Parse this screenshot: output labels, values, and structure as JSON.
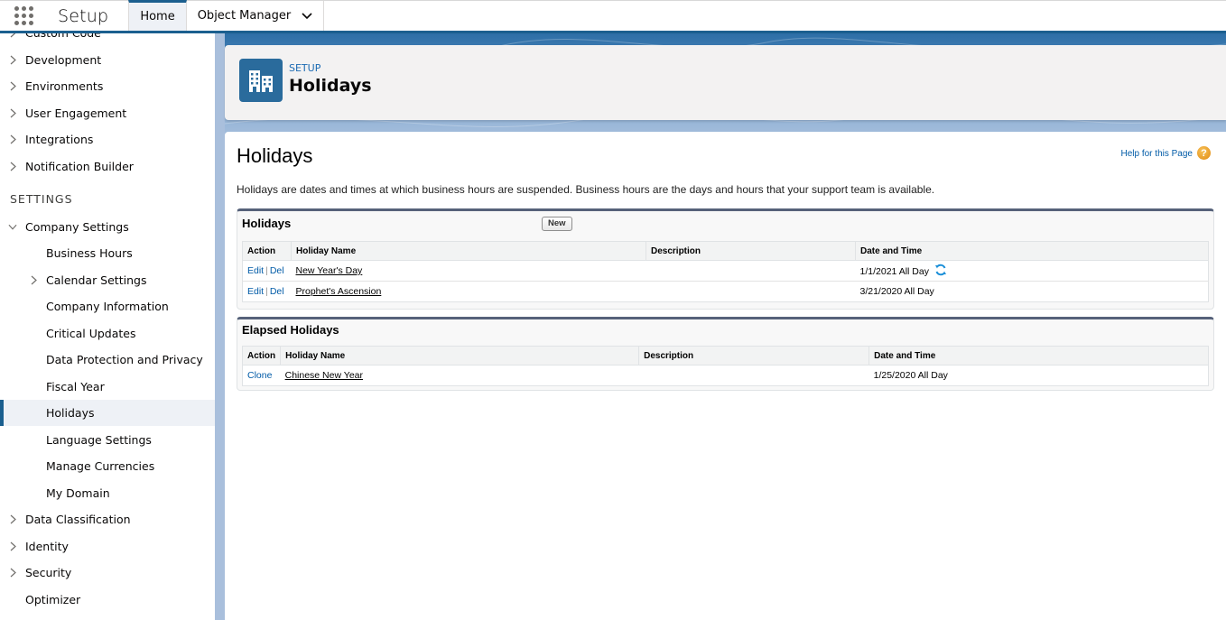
{
  "topbar": {
    "app_name": "Setup",
    "tabs": [
      {
        "label": "Home",
        "active": true
      },
      {
        "label": "Object Manager",
        "has_dropdown": true
      }
    ]
  },
  "sidebar": {
    "partial_item": "Custom Code",
    "top_items": [
      {
        "label": "Development"
      },
      {
        "label": "Environments"
      },
      {
        "label": "User Engagement"
      },
      {
        "label": "Integrations"
      },
      {
        "label": "Notification Builder"
      }
    ],
    "settings_heading": "SETTINGS",
    "company_settings": {
      "label": "Company Settings",
      "expanded": true,
      "children": [
        {
          "label": "Business Hours"
        },
        {
          "label": "Calendar Settings",
          "expandable": true
        },
        {
          "label": "Company Information"
        },
        {
          "label": "Critical Updates"
        },
        {
          "label": "Data Protection and Privacy"
        },
        {
          "label": "Fiscal Year"
        },
        {
          "label": "Holidays",
          "selected": true
        },
        {
          "label": "Language Settings"
        },
        {
          "label": "Manage Currencies"
        },
        {
          "label": "My Domain"
        }
      ]
    },
    "bottom_items": [
      {
        "label": "Data Classification",
        "expandable": true
      },
      {
        "label": "Identity",
        "expandable": true
      },
      {
        "label": "Security",
        "expandable": true
      },
      {
        "label": "Optimizer",
        "expandable": false
      }
    ]
  },
  "header": {
    "icon": "building-icon",
    "eyebrow": "SETUP",
    "title": "Holidays"
  },
  "content": {
    "title": "Holidays",
    "help_link": "Help for this Page",
    "description": "Holidays are dates and times at which business hours are suspended. Business hours are the days and hours that your support team is available.",
    "holidays_list": {
      "title": "Holidays",
      "new_button": "New",
      "columns": [
        "Action",
        "Holiday Name",
        "Description",
        "Date and Time"
      ],
      "rows": [
        {
          "edit": "Edit",
          "sep": "|",
          "del": "Del",
          "name": "New Year's Day",
          "description": "",
          "date": "1/1/2021 All Day",
          "recurring": true
        },
        {
          "edit": "Edit",
          "sep": "|",
          "del": "Del",
          "name": "Prophet's Ascension",
          "description": "",
          "date": "3/21/2020 All Day",
          "recurring": false
        }
      ]
    },
    "elapsed_list": {
      "title": "Elapsed Holidays",
      "columns": [
        "Action",
        "Holiday Name",
        "Description",
        "Date and Time"
      ],
      "rows": [
        {
          "clone": "Clone",
          "name": "Chinese New Year",
          "description": "",
          "date": "1/25/2020 All Day"
        }
      ]
    }
  },
  "colors": {
    "brand": "#1b5f8f",
    "link": "#015ba7",
    "header_icon_bg": "#2a6b9c",
    "help_icon": "#e8961c"
  }
}
